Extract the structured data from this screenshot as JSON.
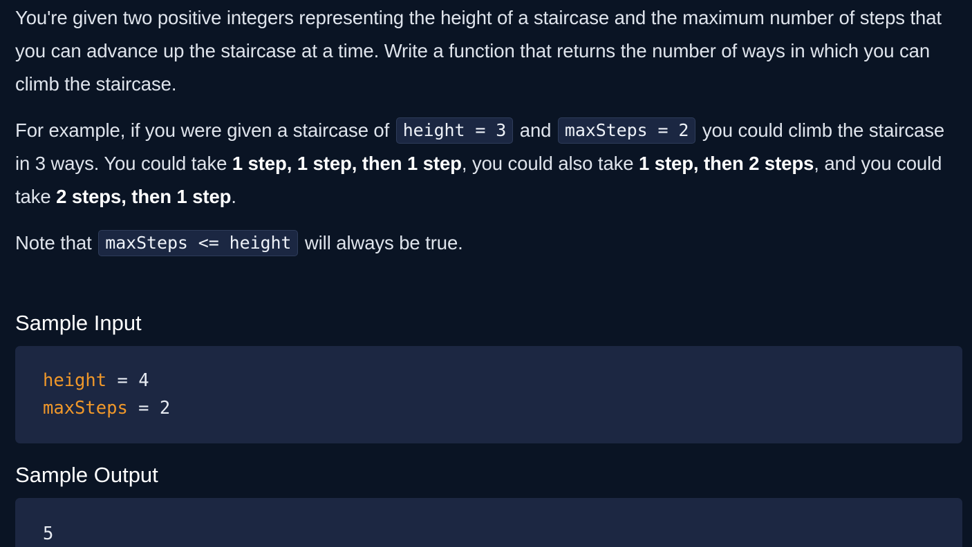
{
  "problem": {
    "p1": "You're given two positive integers representing the height of a staircase and the maximum number of steps that you can advance up the staircase at a time. Write a function that returns the number of ways in which you can climb the staircase.",
    "p2": {
      "t1": "For example, if you were given a staircase of ",
      "c1": "height = 3",
      "t2": " and ",
      "c2": "maxSteps = 2",
      "t3": " you could climb the staircase in 3 ways. You could take ",
      "b1": "1 step, 1 step, then 1 step",
      "t4": ", you could also take ",
      "b2": "1 step, then 2 steps",
      "t5": ", and you could take ",
      "b3": "2 steps, then 1 step",
      "t6": "."
    },
    "p3": {
      "t1": "Note that ",
      "c1": "maxSteps <= height",
      "t2": " will always be true."
    }
  },
  "sample_input": {
    "heading": "Sample Input",
    "lines": [
      {
        "name": "height",
        "op": " = ",
        "value": "4"
      },
      {
        "name": "maxSteps",
        "op": " = ",
        "value": "2"
      }
    ]
  },
  "sample_output": {
    "heading": "Sample Output",
    "value": "5"
  }
}
